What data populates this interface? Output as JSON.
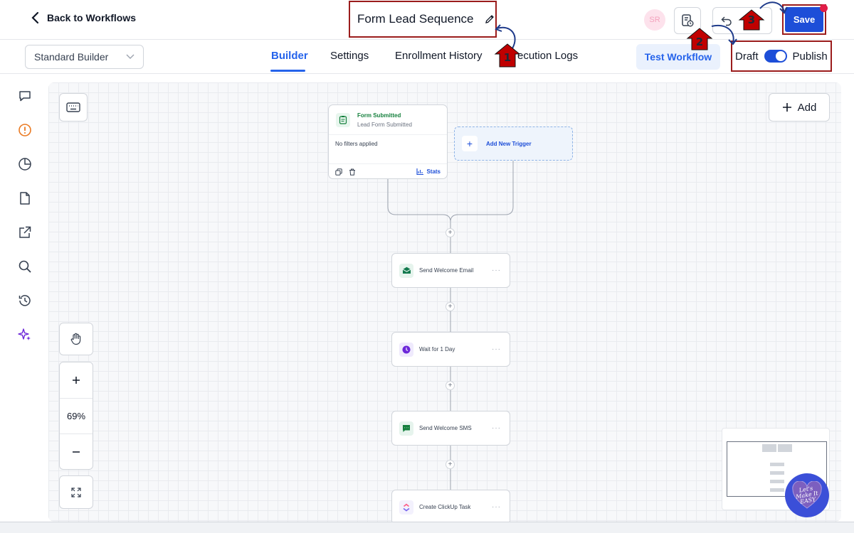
{
  "header": {
    "back_label": "Back to Workflows",
    "workflow_title": "Form Lead Sequence",
    "avatar_initials": "SR",
    "save_label": "Save"
  },
  "subnav": {
    "builder_mode": "Standard Builder",
    "tabs": [
      {
        "label": "Builder",
        "active": true
      },
      {
        "label": "Settings",
        "active": false
      },
      {
        "label": "Enrollment History",
        "active": false
      },
      {
        "label": "ecution Logs",
        "active": false
      }
    ],
    "test_label": "Test Workflow",
    "draft_label": "Draft",
    "publish_label": "Publish"
  },
  "rail": {
    "icons": [
      "chat-icon",
      "alert-circle-icon",
      "pie-chart-icon",
      "file-icon",
      "external-link-icon",
      "search-icon",
      "history-icon",
      "sparkle-icon"
    ]
  },
  "canvas": {
    "add_label": "Add",
    "zoom_level": "69%",
    "trigger": {
      "title": "Form Submitted",
      "subtitle": "Lead Form Submitted",
      "filters": "No filters applied",
      "stats_label": "Stats"
    },
    "new_trigger_label": "Add New Trigger",
    "actions": [
      {
        "label": "Send Welcome Email",
        "icon": "email-icon",
        "color": "#137a4e"
      },
      {
        "label": "Wait for 1 Day",
        "icon": "clock-icon",
        "color": "#6d28d9"
      },
      {
        "label": "Send Welcome SMS",
        "icon": "sms-icon",
        "color": "#15803d"
      },
      {
        "label": "Create ClickUp Task",
        "icon": "clickup-icon",
        "color": "#7b68ee"
      }
    ]
  },
  "annotations": [
    "1",
    "2",
    "3"
  ],
  "watermark": "Let's Make It EASY",
  "colors": {
    "primary": "#1d4ed8",
    "annotation_border": "#9b1c1c",
    "annotation_arrow": "#c00000"
  }
}
